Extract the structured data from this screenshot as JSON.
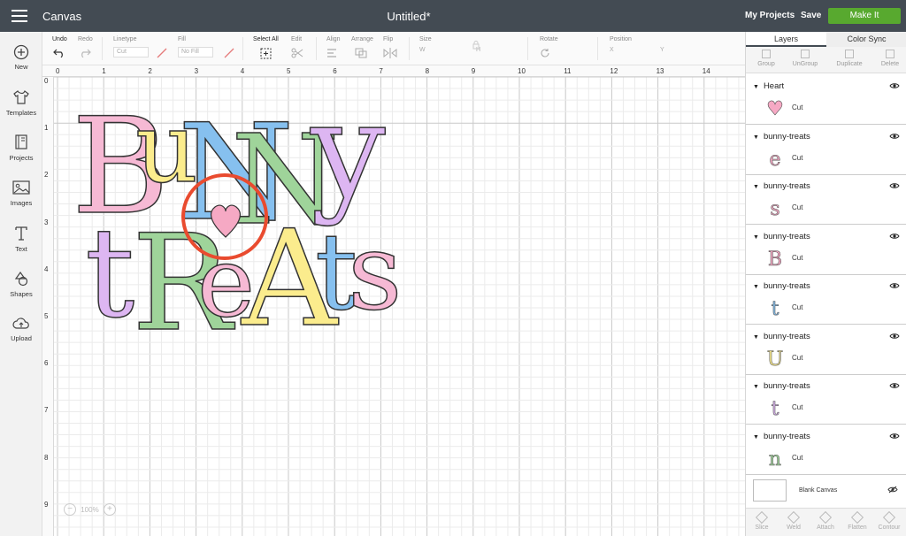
{
  "topbar": {
    "app_title": "Canvas",
    "doc_title": "Untitled*",
    "my_projects": "My Projects",
    "save": "Save",
    "make_it": "Make It"
  },
  "leftbar": {
    "items": [
      {
        "label": "New",
        "icon": "plus-circle-icon"
      },
      {
        "label": "Templates",
        "icon": "shirt-icon"
      },
      {
        "label": "Projects",
        "icon": "projects-icon"
      },
      {
        "label": "Images",
        "icon": "image-icon"
      },
      {
        "label": "Text",
        "icon": "text-icon"
      },
      {
        "label": "Shapes",
        "icon": "shapes-icon"
      },
      {
        "label": "Upload",
        "icon": "upload-icon"
      }
    ]
  },
  "toolbar": {
    "undo": "Undo",
    "redo": "Redo",
    "linetype": "Linetype",
    "linetype_value": "Cut",
    "fill": "Fill",
    "fill_value": "No Fill",
    "select_all": "Select All",
    "edit": "Edit",
    "align": "Align",
    "arrange": "Arrange",
    "flip": "Flip",
    "size": "Size",
    "size_w": "W",
    "size_h": "H",
    "rotate": "Rotate",
    "position": "Position",
    "pos_x": "X",
    "pos_y": "Y"
  },
  "rulers": {
    "top": [
      "0",
      "1",
      "2",
      "3",
      "4",
      "5",
      "6",
      "7",
      "8",
      "9",
      "10",
      "11",
      "12",
      "13",
      "14"
    ],
    "left": [
      "0",
      "1",
      "2",
      "3",
      "4",
      "5",
      "6",
      "7",
      "8",
      "9"
    ]
  },
  "canvas": {
    "zoom": "100%",
    "zoom_out": "−",
    "zoom_in": "+"
  },
  "rightpanel": {
    "tabs": [
      "Layers",
      "Color Sync"
    ],
    "tools": [
      "Group",
      "UnGroup",
      "Duplicate",
      "Delete"
    ],
    "layers": [
      {
        "name": "Heart",
        "op": "Cut",
        "color": "#f6a9c4",
        "glyph": "♥"
      },
      {
        "name": "bunny-treats",
        "op": "Cut",
        "color": "#f6a9c4",
        "glyph": "e"
      },
      {
        "name": "bunny-treats",
        "op": "Cut",
        "color": "#f6a9c4",
        "glyph": "s"
      },
      {
        "name": "bunny-treats",
        "op": "Cut",
        "color": "#f6a9c4",
        "glyph": "B"
      },
      {
        "name": "bunny-treats",
        "op": "Cut",
        "color": "#86c0ef",
        "glyph": "t"
      },
      {
        "name": "bunny-treats",
        "op": "Cut",
        "color": "#fbec8d",
        "glyph": "U"
      },
      {
        "name": "bunny-treats",
        "op": "Cut",
        "color": "#ddb6f2",
        "glyph": "t"
      },
      {
        "name": "bunny-treats",
        "op": "Cut",
        "color": "#9fd49a",
        "glyph": "n"
      }
    ],
    "blank_canvas": "Blank Canvas",
    "bottom_tools": [
      "Slice",
      "Weld",
      "Attach",
      "Flatten",
      "Contour"
    ]
  },
  "artwork": {
    "line1": [
      "B",
      "u",
      "N",
      "N",
      "y"
    ],
    "line2": [
      "t",
      "R",
      "e",
      "A",
      "t",
      "s"
    ],
    "line1_colors": [
      "#f6b9d4",
      "#fbec8d",
      "#86c0ef",
      "#9fd49a",
      "#ddb6f2"
    ],
    "line2_colors": [
      "#ddb6f2",
      "#9fd49a",
      "#f6b9d4",
      "#fbec8d",
      "#86c0ef",
      "#f6b9d4"
    ],
    "heart_color": "#f6a9c4",
    "circle_color": "#e94b2f"
  }
}
